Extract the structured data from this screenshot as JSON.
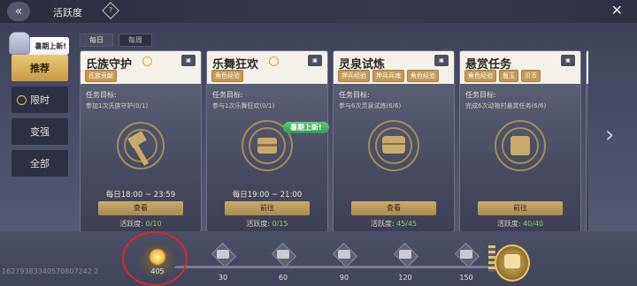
{
  "header": {
    "title": "活跃度",
    "help_icon": "?",
    "close_icon": "✕",
    "back_icon": "«"
  },
  "tabs": [
    {
      "label": "每日",
      "active": true
    },
    {
      "label": "每周",
      "active": false
    }
  ],
  "sidebar": {
    "promo_label": "暑期上新!",
    "items": [
      {
        "label": "推荐",
        "active": true
      },
      {
        "label": "限时",
        "active": false
      },
      {
        "label": "变强",
        "active": false
      },
      {
        "label": "全部",
        "active": false
      }
    ]
  },
  "cards": [
    {
      "name": "氏族守护",
      "tags": [
        "氏族贡献"
      ],
      "goal_label": "任务目标:",
      "goal_desc": "参加1次氏族守护(0/1)",
      "time": "每日18:00 ~ 23:59",
      "button": "查看",
      "activity_label": "活跃度:",
      "activity_value": "0/10"
    },
    {
      "name": "乐舞狂欢",
      "tags": [
        "角色经验"
      ],
      "goal_label": "任务目标:",
      "goal_desc": "参与1次乐舞狂欢(0/1)",
      "time": "每日19:00 ~ 21:00",
      "button": "前往",
      "activity_label": "活跃度:",
      "activity_value": "0/15"
    },
    {
      "name": "灵泉试炼",
      "tags": [
        "押兵经验",
        "押兵兵魂",
        "角色经验"
      ],
      "goal_label": "任务目标:",
      "goal_desc": "参与6次灵泉试炼(6/6)",
      "time": "",
      "button": "查看",
      "activity_label": "活跃度:",
      "activity_value": "45/45",
      "badge": "暑期上新!"
    },
    {
      "name": "悬赏任务",
      "tags": [
        "角色经验",
        "瓶玉",
        "贝币"
      ],
      "goal_label": "任务目标:",
      "goal_desc": "完成6次动物村悬赏任务(6/6)",
      "time": "",
      "button": "前往",
      "activity_label": "活跃度:",
      "activity_value": "40/40"
    }
  ],
  "footer": {
    "uid": "16279383340570807242 2",
    "points": "405",
    "milestones": [
      "30",
      "60",
      "90",
      "120",
      "150"
    ]
  },
  "colors": {
    "accent_gold": "#c8ac6e",
    "complete_green": "#7fd36a",
    "highlight_red": "#d62a2a"
  }
}
